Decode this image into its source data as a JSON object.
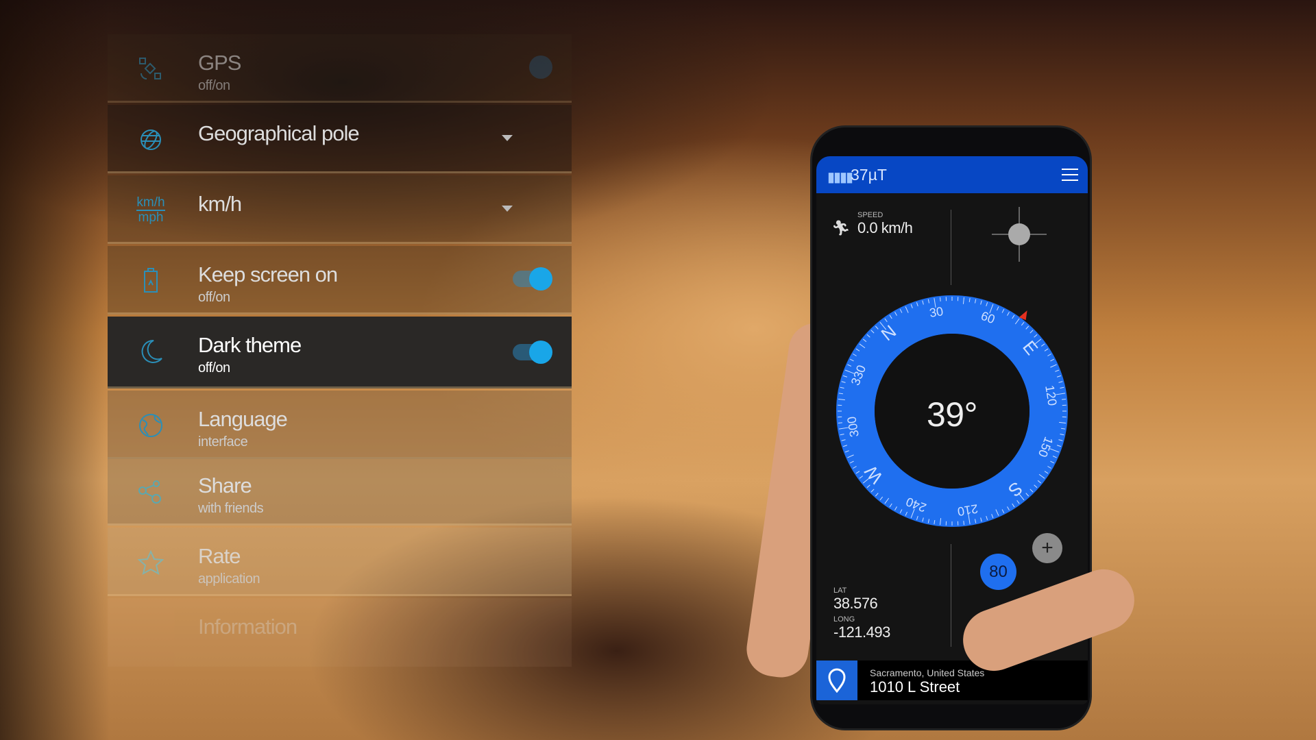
{
  "settings": {
    "rows": [
      {
        "title": "GPS",
        "subtitle": "off/on",
        "icon": "satellite-icon",
        "control": "toggle",
        "on": false
      },
      {
        "title": "Geographical pole",
        "icon": "globe-icon",
        "control": "dropdown"
      },
      {
        "title": "km/h",
        "icon": "units-icon",
        "icon_text_top": "km/h",
        "icon_text_bottom": "mph",
        "control": "dropdown"
      },
      {
        "title": "Keep screen on",
        "subtitle": "off/on",
        "icon": "battery-icon",
        "control": "toggle",
        "on": true
      },
      {
        "title": "Dark theme",
        "subtitle": "off/on",
        "icon": "moon-icon",
        "control": "toggle",
        "on": true
      },
      {
        "title": "Language",
        "subtitle": "interface",
        "icon": "earth-icon"
      },
      {
        "title": "Share",
        "subtitle": "with friends",
        "icon": "share-icon"
      },
      {
        "title": "Rate",
        "subtitle": "application",
        "icon": "star-icon"
      },
      {
        "title": "Information",
        "icon": "info-icon"
      }
    ]
  },
  "phone": {
    "header": {
      "field": "37µT",
      "bars_icon": "signal-bars-icon",
      "menu_icon": "hamburger-menu-icon"
    },
    "speed": {
      "label": "SPEED",
      "value": "0.0 km/h",
      "icon": "running-icon"
    },
    "compass": {
      "heading": "39°",
      "heading_deg": 39,
      "labels": [
        "N",
        "30",
        "60",
        "E",
        "120",
        "150",
        "S",
        "210",
        "240",
        "W",
        "300",
        "330"
      ]
    },
    "zoom_value": "80",
    "plus_label": "+",
    "lat": {
      "label": "LAT",
      "value": "38.576"
    },
    "long": {
      "label": "LONG",
      "value": "-121.493"
    },
    "location": {
      "city": "Sacramento, United States",
      "street": "1010 L Street",
      "icon": "location-pin-icon"
    }
  },
  "colors": {
    "accent": "#0747c4",
    "compass_ring": "#1f6fef",
    "toggle": "#19a6e8",
    "marker": "#e53020"
  }
}
